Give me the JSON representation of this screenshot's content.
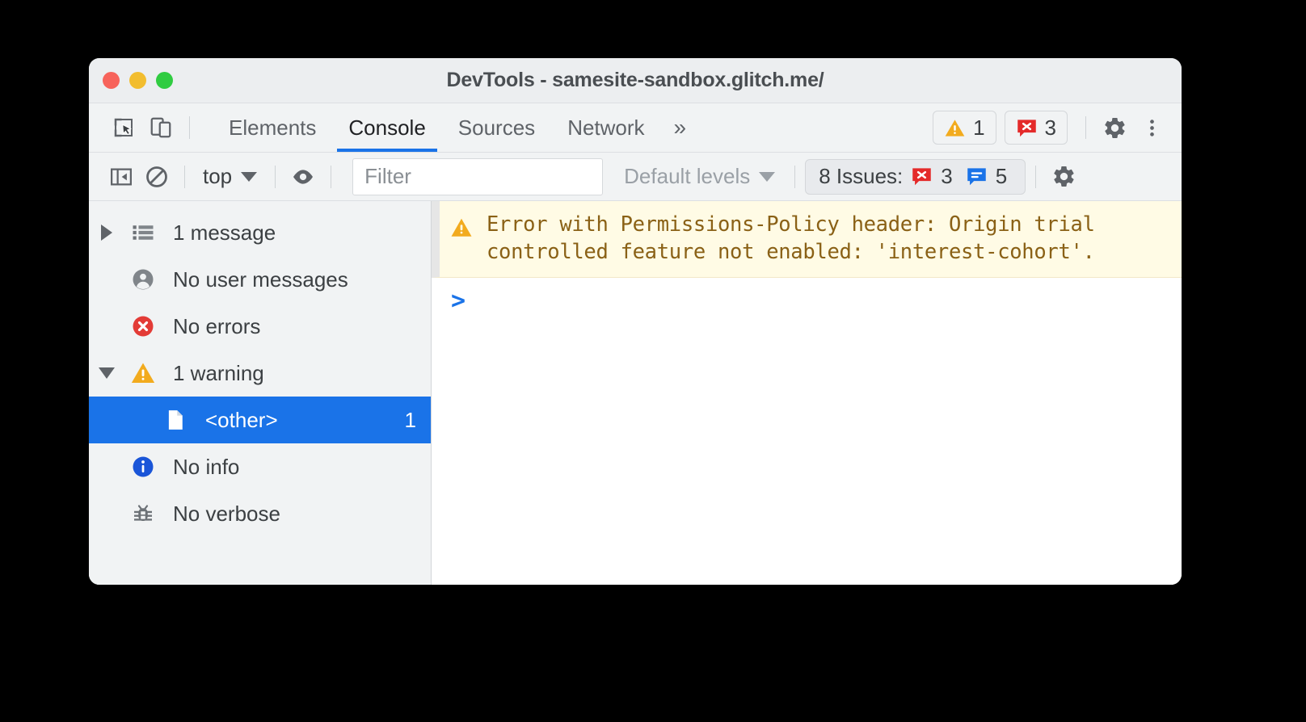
{
  "window": {
    "title": "DevTools - samesite-sandbox.glitch.me/",
    "traffic_lights": [
      "close",
      "minimize",
      "maximize"
    ]
  },
  "tabbar": {
    "inspect_icon": "inspect-element-icon",
    "device_icon": "device-toolbar-icon",
    "tabs": [
      {
        "label": "Elements",
        "active": false
      },
      {
        "label": "Console",
        "active": true
      },
      {
        "label": "Sources",
        "active": false
      },
      {
        "label": "Network",
        "active": false
      }
    ],
    "more_tabs": "»",
    "warning_count": "1",
    "error_count": "3",
    "settings_icon": "gear-icon",
    "kebab_icon": "more-options-icon"
  },
  "console_toolbar": {
    "sidebar_toggle_icon": "show-console-sidebar-icon",
    "clear_icon": "clear-console-icon",
    "context": "top",
    "eye_icon": "live-expression-icon",
    "filter_placeholder": "Filter",
    "filter_value": "",
    "levels": "Default levels",
    "issues_label": "8 Issues:",
    "issues_error_count": "3",
    "issues_info_count": "5",
    "settings_icon": "gear-icon"
  },
  "sidebar": {
    "items": [
      {
        "label": "1 message",
        "icon": "list-icon",
        "twisty": "right",
        "count": "",
        "selected": false,
        "indent": false
      },
      {
        "label": "No user messages",
        "icon": "person-icon",
        "twisty": "none",
        "count": "",
        "selected": false,
        "indent": false
      },
      {
        "label": "No errors",
        "icon": "error-icon",
        "twisty": "none",
        "count": "",
        "selected": false,
        "indent": false
      },
      {
        "label": "1 warning",
        "icon": "warning-icon",
        "twisty": "down",
        "count": "",
        "selected": false,
        "indent": false
      },
      {
        "label": "<other>",
        "icon": "document-icon",
        "twisty": "none",
        "count": "1",
        "selected": true,
        "indent": true
      },
      {
        "label": "No info",
        "icon": "info-icon",
        "twisty": "none",
        "count": "",
        "selected": false,
        "indent": false
      },
      {
        "label": "No verbose",
        "icon": "bug-icon",
        "twisty": "none",
        "count": "",
        "selected": false,
        "indent": false
      }
    ]
  },
  "console_output": {
    "messages": [
      {
        "level": "warning",
        "icon": "warning-icon",
        "text": "Error with Permissions-Policy header: Origin trial\ncontrolled feature not enabled: 'interest-cohort'."
      }
    ],
    "prompt": ">"
  },
  "colors": {
    "accent_blue": "#1a73e8",
    "warning_yellow": "#f2ab1e",
    "error_red": "#e42a2a",
    "info_blue": "#1a73e8",
    "warning_bg": "#fffbe5",
    "warning_text": "#8a6116",
    "chrome_bg": "#f1f3f4"
  }
}
